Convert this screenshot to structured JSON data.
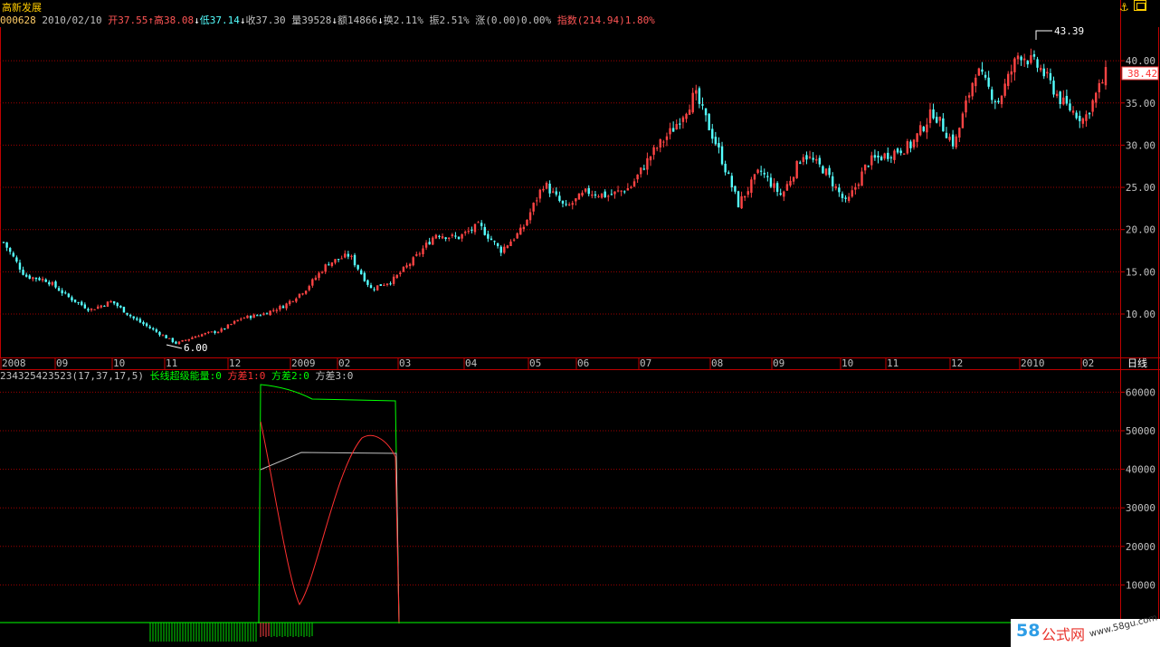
{
  "header": {
    "stock_name": "高新发展",
    "info_line": [
      {
        "text": "000628",
        "color": "#ffcc66"
      },
      {
        "text": " 2010/02/10 ",
        "color": "#c0c0c0"
      },
      {
        "text": "开37.55",
        "color": "#ff5555"
      },
      {
        "text": "↑",
        "color": "#ff5555"
      },
      {
        "text": "高38.08",
        "color": "#ff5555"
      },
      {
        "text": "↓",
        "color": "#ffffff"
      },
      {
        "text": "低37.14",
        "color": "#54ffff"
      },
      {
        "text": "↓",
        "color": "#ffffff"
      },
      {
        "text": "收37.30",
        "color": "#c0c0c0"
      },
      {
        "text": " 量39528",
        "color": "#c0c0c0"
      },
      {
        "text": "↓",
        "color": "#ffffff"
      },
      {
        "text": "额14866",
        "color": "#c0c0c0"
      },
      {
        "text": "↓",
        "color": "#ffffff"
      },
      {
        "text": "换2.11%",
        "color": "#c0c0c0"
      },
      {
        "text": " 振2.51%",
        "color": "#c0c0c0"
      },
      {
        "text": " 涨(0.00)0.00%",
        "color": "#c0c0c0"
      },
      {
        "text": " 指数(214.94)1.80%",
        "color": "#ff5555"
      }
    ]
  },
  "icons": {
    "anchor": "anchor-icon",
    "window": "window-icon"
  },
  "price_axis": {
    "labels": [
      "40.00",
      "35.00",
      "30.00",
      "25.00",
      "20.00",
      "15.00",
      "10.00"
    ],
    "current_price": "38.42"
  },
  "annotations": {
    "high": "43.39",
    "low": "6.00"
  },
  "time_axis": {
    "labels": [
      "2008",
      "09",
      "10",
      "11",
      "12",
      "2009",
      "02",
      "03",
      "04",
      "05",
      "06",
      "07",
      "08",
      "09",
      "10",
      "11",
      "12",
      "2010",
      "02"
    ],
    "period": "日线"
  },
  "indicator": {
    "legend": [
      {
        "text": "234325423523(17,37,17,5)",
        "color": "#c0c0c0"
      },
      {
        "text": " 长线超级能量:0",
        "color": "#00ff00"
      },
      {
        "text": " 方差1:0",
        "color": "#ff3333"
      },
      {
        "text": " 方差2:0",
        "color": "#00ff00"
      },
      {
        "text": " 方差3:0",
        "color": "#c0c0c0"
      }
    ],
    "axis_labels": [
      "60000",
      "50000",
      "40000",
      "30000",
      "20000",
      "10000"
    ]
  },
  "watermark": {
    "brand_58": "58",
    "brand_rest": "公式网",
    "url": "www.58gu.com"
  },
  "colors": {
    "up": "#ff4444",
    "down": "#54ffff",
    "grid": "#a00000",
    "frame": "#c00000",
    "axis_text": "#c0c0c0"
  },
  "chart_data": {
    "type": "candlestick",
    "x_labels": [
      "2008",
      "09",
      "10",
      "11",
      "12",
      "2009",
      "02",
      "03",
      "04",
      "05",
      "06",
      "07",
      "08",
      "09",
      "10",
      "11",
      "12",
      "2010",
      "02"
    ],
    "ylim": [
      6.0,
      43.39
    ],
    "high": 43.39,
    "low": 6.0,
    "last_price": 38.42,
    "trend_close": [
      18.5,
      14.5,
      14.0,
      12.0,
      10.5,
      11.5,
      9.5,
      8.0,
      6.5,
      7.5,
      8.0,
      9.5,
      10.0,
      11.0,
      13.0,
      16.0,
      17.0,
      13.0,
      14.0,
      16.5,
      19.5,
      19.0,
      20.5,
      17.5,
      20.0,
      25.5,
      22.5,
      24.5,
      24.0,
      25.0,
      29.0,
      32.0,
      36.0,
      30.0,
      23.0,
      27.0,
      24.0,
      29.0,
      27.0,
      23.0,
      28.0,
      29.0,
      30.0,
      34.0,
      30.0,
      39.0,
      35.0,
      41.0,
      39.0,
      35.0,
      33.0,
      38.4
    ],
    "indicator": {
      "name": "234325423523(17,37,17,5)",
      "params": [
        17,
        37,
        17,
        5
      ],
      "ylim": [
        0,
        62000
      ],
      "series": [
        {
          "name": "长线超级能量",
          "value": 0
        },
        {
          "name": "方差1",
          "value": 0
        },
        {
          "name": "方差2",
          "value": 0
        },
        {
          "name": "方差3",
          "value": 0
        }
      ]
    }
  }
}
